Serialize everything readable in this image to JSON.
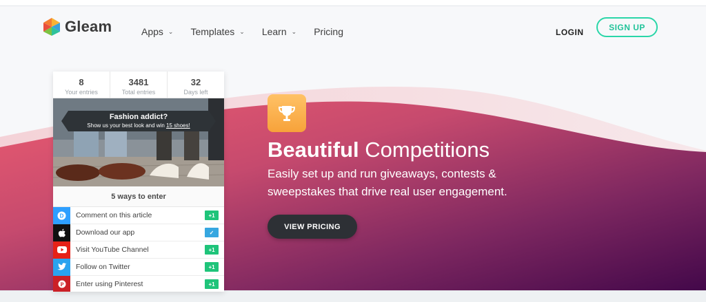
{
  "brand": {
    "name": "Gleam"
  },
  "nav": {
    "items": [
      {
        "label": "Apps",
        "has_dropdown": true
      },
      {
        "label": "Templates",
        "has_dropdown": true
      },
      {
        "label": "Learn",
        "has_dropdown": true
      },
      {
        "label": "Pricing",
        "has_dropdown": false
      }
    ],
    "login_label": "LOGIN",
    "signup_label": "SIGN UP"
  },
  "widget": {
    "stats": [
      {
        "value": "8",
        "label": "Your entries"
      },
      {
        "value": "3481",
        "label": "Total entries"
      },
      {
        "value": "32",
        "label": "Days left"
      }
    ],
    "banner_title": "Fashion addict?",
    "banner_sub_prefix": "Show us your best look and win ",
    "banner_sub_link": "15 shoes!",
    "ways_label": "5 ways to enter",
    "entries": [
      {
        "label": "Comment on this article",
        "icon": "disqus-icon",
        "color": "#2e9fff",
        "badge": "+1",
        "completed": false
      },
      {
        "label": "Download our app",
        "icon": "apple-icon",
        "color": "#111111",
        "badge": "✓",
        "completed": true
      },
      {
        "label": "Visit YouTube Channel",
        "icon": "youtube-icon",
        "color": "#e62117",
        "badge": "+1",
        "completed": false
      },
      {
        "label": "Follow on Twitter",
        "icon": "twitter-icon",
        "color": "#2aa3ef",
        "badge": "+1",
        "completed": false
      },
      {
        "label": "Enter using Pinterest",
        "icon": "pinterest-icon",
        "color": "#cb2027",
        "badge": "+1",
        "completed": false
      }
    ]
  },
  "hero": {
    "headline_bold": "Beautiful",
    "headline_rest": " Competitions",
    "subhead": "Easily set up and run giveaways, contests & sweepstakes that drive real user engagement.",
    "cta_label": "VIEW PRICING",
    "icon": "trophy-icon"
  },
  "colors": {
    "accent_green": "#2ad6a8",
    "wave_start": "#e8596f",
    "wave_end": "#4a0a4a",
    "trophy_bg": "#f7a23a"
  }
}
